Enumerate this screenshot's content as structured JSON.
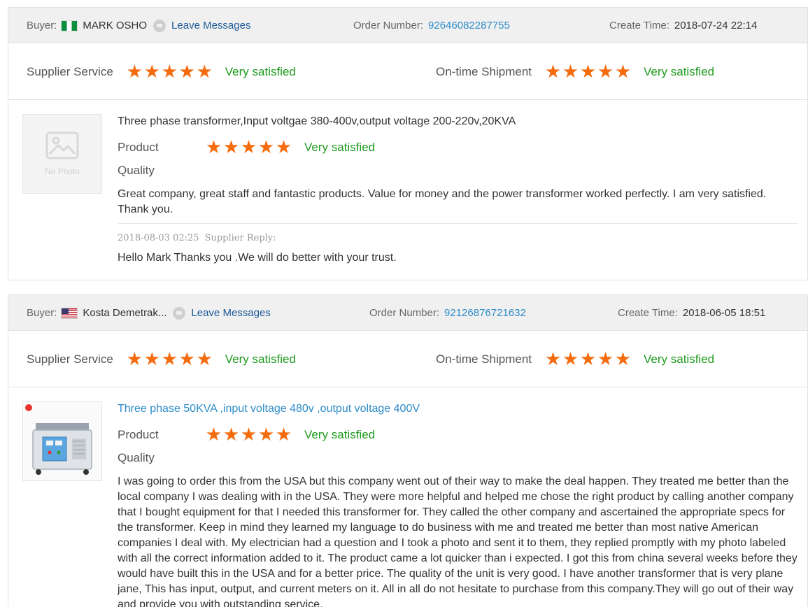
{
  "labels": {
    "buyer": "Buyer:",
    "leave_messages": "Leave Messages",
    "order_number": "Order Number:",
    "create_time": "Create Time:",
    "supplier_service": "Supplier Service",
    "ontime_shipment": "On-time Shipment",
    "product": "Product",
    "quality": "Quality",
    "very_satisfied": "Very satisfied",
    "no_photo": "No Photo",
    "supplier_reply": "Supplier Reply:"
  },
  "colors": {
    "star": "#f56c0e",
    "satisfied": "#1e9a1e",
    "link": "#2e8cc9",
    "header_bg": "#f0f0f0"
  },
  "reviews": [
    {
      "buyer_flag": "nigeria-flag",
      "buyer_name": "MARK OSHO",
      "order_number": "92646082287755",
      "create_time": "2018-07-24 22:14",
      "supplier_service_stars": 5,
      "ontime_shipment_stars": 5,
      "product_title": "Three phase transformer,Input voltgae 380-400v,output voltage 200-220v,20KVA",
      "product_stars": 5,
      "comment": "Great company, great staff and fantastic products. Value for money and the power transformer worked perfectly. I am very satisfied. Thank you.",
      "reply_time": "2018-08-03 02:25",
      "reply_text": "Hello Mark Thanks you .We will do better with your trust."
    },
    {
      "buyer_flag": "usa-flag",
      "buyer_name": "Kosta Demetrak...",
      "order_number": "92126876721632",
      "create_time": "2018-06-05 18:51",
      "supplier_service_stars": 5,
      "ontime_shipment_stars": 5,
      "product_title": "Three phase 50KVA ,input voltage 480v ,output voltage 400V",
      "product_stars": 5,
      "comment": "I was going to order this from the USA but this company went out of their way to make the deal happen. They treated me better than the local company I was dealing with in the USA. They were more helpful and helped me chose the right product by calling another company that I bought equipment for that I needed this transformer for. They called the other company and ascertained the appropriate specs for the transformer. Keep in mind they learned my language to do business with me and treated me better than most native American companies I deal with. My electrician had a question and I took a photo and sent it to them, they replied promptly with my photo labeled with all the correct information added to it. The product came a lot quicker than i expected. I got this from china several weeks before they would have built this in the USA and for a better price. The quality of the unit is very good. I have another transformer that is very plane jane, This has input, output, and current meters on it. All in all do not hesitate to purchase from this company.They will go out of their way and provide you with outstanding service."
    }
  ]
}
